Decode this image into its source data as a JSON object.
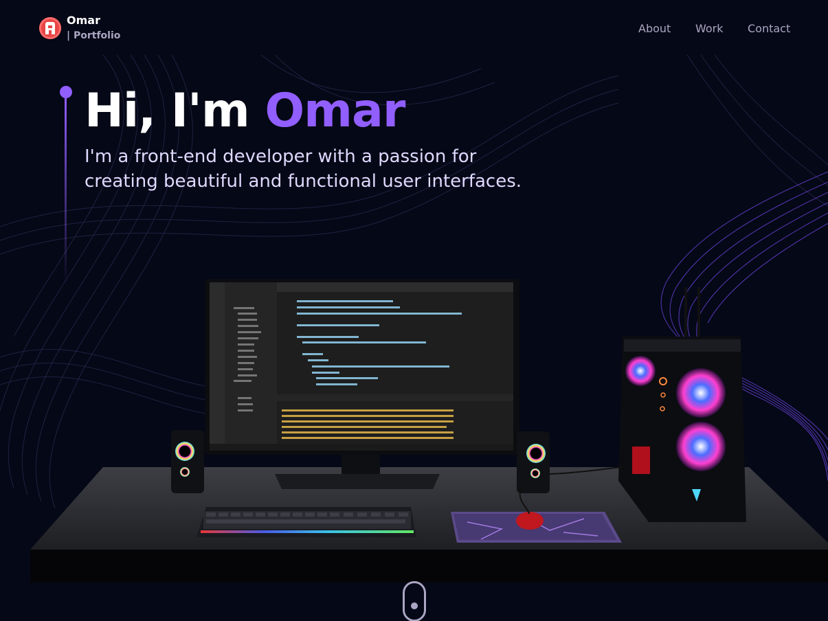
{
  "nav": {
    "brand_name": "Omar",
    "brand_sub": "| Portfolio",
    "links": [
      "About",
      "Work",
      "Contact"
    ]
  },
  "hero": {
    "greeting": "Hi, I'm ",
    "name": "Omar",
    "subtitle": "I'm a front-end developer with a passion for creating beautiful and functional user interfaces."
  },
  "colors": {
    "background": "#050816",
    "accent": "#915eff",
    "secondary_text": "#aaa6c3"
  },
  "icons": [
    "logo-icon",
    "scroll-down-icon"
  ]
}
